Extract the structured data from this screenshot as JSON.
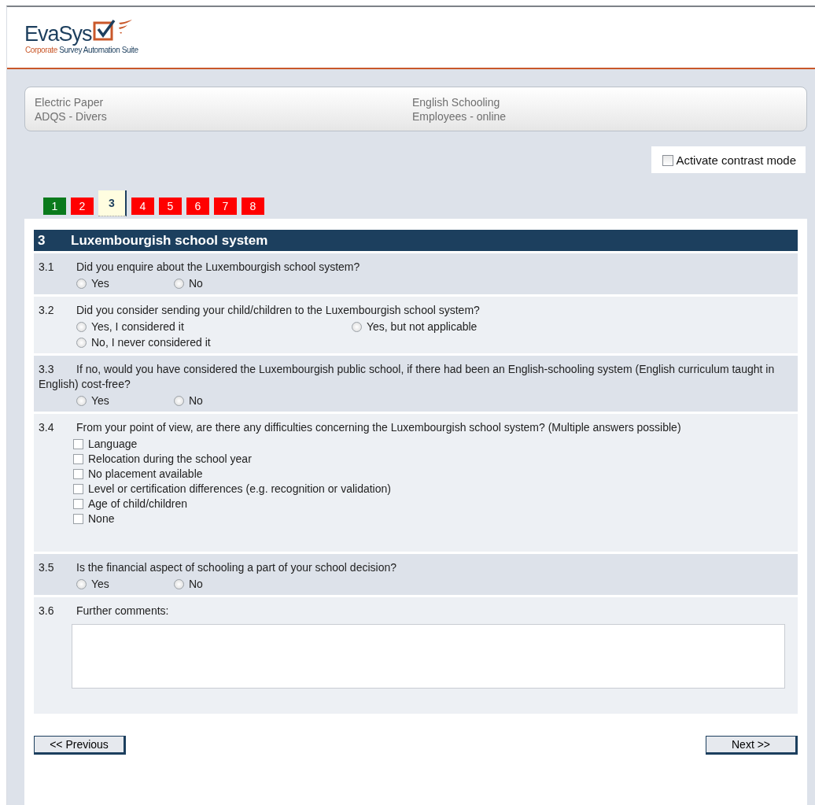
{
  "logo": {
    "name": "EvaSys",
    "tagline_accent": "Corporate",
    "tagline": " Survey Automation Suite"
  },
  "info": {
    "left": [
      "Electric Paper",
      "ADQS - Divers"
    ],
    "right": [
      "English Schooling",
      "Employees - online"
    ]
  },
  "contrast_mode": {
    "label": "Activate contrast mode",
    "checked": false
  },
  "pages": [
    {
      "label": "1",
      "color": "#0a7a1c",
      "selected": false
    },
    {
      "label": "2",
      "color": "#ff0000",
      "selected": false
    },
    {
      "label": "3",
      "color": "#fffde0",
      "selected": true
    },
    {
      "label": "4",
      "color": "#ff0000",
      "selected": false
    },
    {
      "label": "5",
      "color": "#ff0000",
      "selected": false
    },
    {
      "label": "6",
      "color": "#ff0000",
      "selected": false
    },
    {
      "label": "7",
      "color": "#ff0000",
      "selected": false
    },
    {
      "label": "8",
      "color": "#ff0000",
      "selected": false
    }
  ],
  "section": {
    "number": "3",
    "title": "Luxembourgish school system"
  },
  "questions": [
    {
      "number": "3.1",
      "text": "Did you enquire about the Luxembourgish school system?",
      "kind": "radio",
      "options": [
        {
          "label": "Yes",
          "selected": false
        },
        {
          "label": "No",
          "selected": false
        }
      ]
    },
    {
      "number": "3.2",
      "text": "Did you consider sending your child/children to the Luxembourgish school system?",
      "kind": "radio",
      "options": [
        {
          "label": "Yes, I considered it",
          "selected": false
        },
        {
          "label": "Yes, but not applicable",
          "selected": false
        },
        {
          "label": "No, I never considered it",
          "selected": false
        }
      ]
    },
    {
      "number": "3.3",
      "text": "If no, would you have considered the Luxembourgish public school, if there had been an English-schooling system (English curriculum taught in English) cost-free?",
      "kind": "radio",
      "options": [
        {
          "label": "Yes",
          "selected": false
        },
        {
          "label": "No",
          "selected": false
        }
      ]
    },
    {
      "number": "3.4",
      "text": "From your point of view, are there any difficulties concerning the Luxembourgish school system? (Multiple answers possible)",
      "kind": "checkbox",
      "options": [
        {
          "label": "Language",
          "checked": false
        },
        {
          "label": "Relocation during the school year",
          "checked": false
        },
        {
          "label": "No placement available",
          "checked": false
        },
        {
          "label": "Level or certification differences (e.g. recognition or validation)",
          "checked": false
        },
        {
          "label": "Age of child/children",
          "checked": false
        },
        {
          "label": "None",
          "checked": false
        }
      ]
    },
    {
      "number": "3.5",
      "text": "Is the financial aspect of schooling a part of your school decision?",
      "kind": "radio",
      "options": [
        {
          "label": "Yes",
          "selected": false
        },
        {
          "label": "No",
          "selected": false
        }
      ]
    },
    {
      "number": "3.6",
      "text": "Further comments:",
      "kind": "text"
    }
  ],
  "buttons": {
    "previous": "<< Previous",
    "next": "Next >>"
  }
}
